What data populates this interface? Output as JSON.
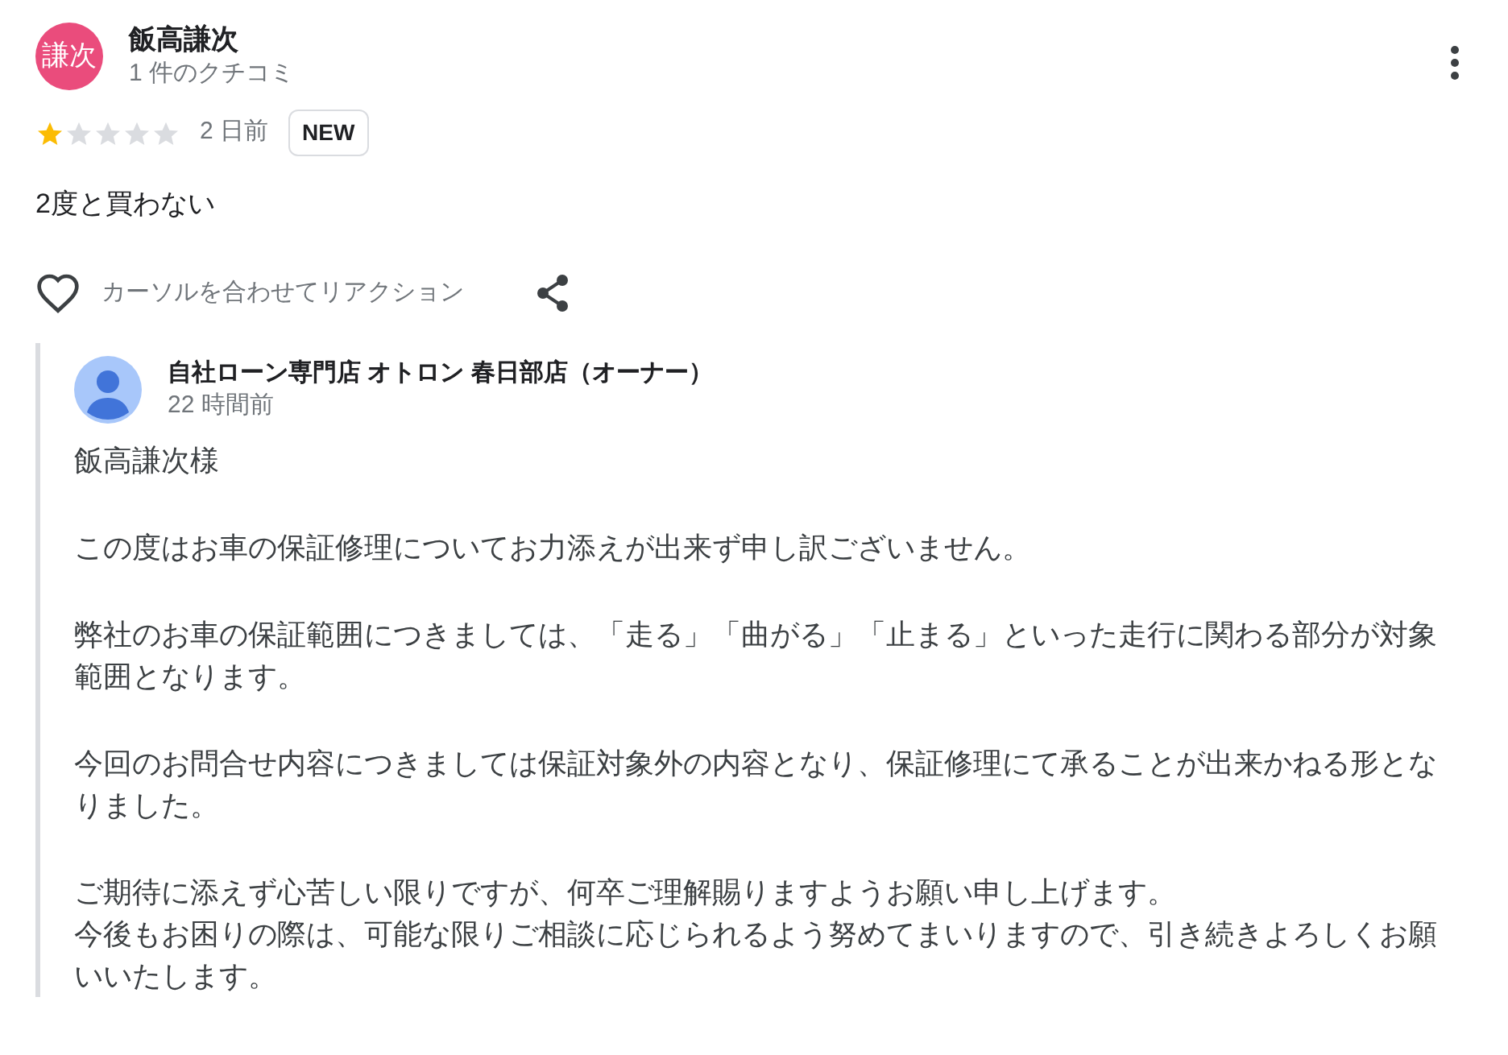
{
  "review": {
    "avatar_text": "謙次",
    "author": "飯高謙次",
    "author_meta": "1 件のクチコミ",
    "stars": 1,
    "time": "2 日前",
    "badge": "NEW",
    "text": "2度と買わない",
    "reaction_label": "カーソルを合わせてリアクション"
  },
  "owner_reply": {
    "author": "自社ローン専門店 オトロン 春日部店（オーナー）",
    "time": "22 時間前",
    "paragraphs": [
      {
        "lines": [
          "飯高謙次様"
        ]
      },
      {
        "lines": [
          "この度はお車の保証修理についてお力添えが出来ず申し訳ございません。"
        ]
      },
      {
        "lines": [
          "弊社のお車の保証範囲につきましては、「走る」「曲がる」「止まる」といった走行に関わる部分が対象範囲となります。"
        ]
      },
      {
        "lines": [
          "今回のお問合せ内容につきましては保証対象外の内容となり、保証修理にて承ることが出来かねる形となりました。"
        ]
      },
      {
        "lines": [
          "ご期待に添えず心苦しい限りですが、何卒ご理解賜りますようお願い申し上げます。",
          "今後もお困りの際は、可能な限りご相談に応じられるよう努めてまいりますので、引き続きよろしくお願いいたします。"
        ]
      }
    ]
  }
}
